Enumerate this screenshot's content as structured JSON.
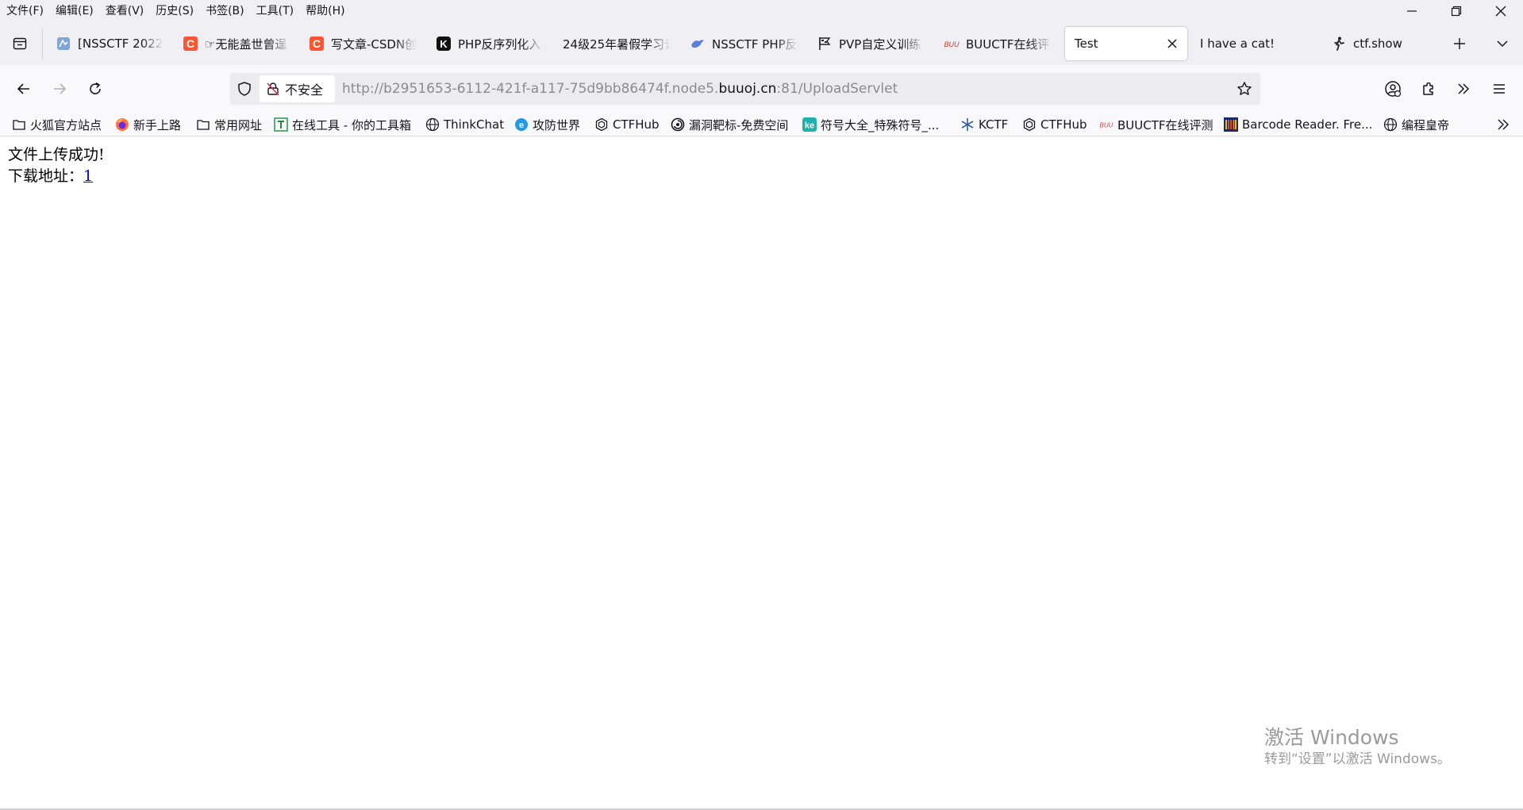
{
  "menubar": {
    "items": [
      "文件(F)",
      "编辑(E)",
      "查看(V)",
      "历史(S)",
      "书签(B)",
      "工具(T)",
      "帮助(H)"
    ]
  },
  "window_controls": [
    "minimize-icon",
    "restore-icon",
    "close-icon"
  ],
  "tabs": [
    {
      "label": "[NSSCTF 2022",
      "icon": "nssctf-logo-icon",
      "active": false
    },
    {
      "label": "☞无能盖世曾逞",
      "icon": "csdn-c-icon",
      "active": false
    },
    {
      "label": "写文章-CSDN创",
      "icon": "csdn-c-icon",
      "active": false
    },
    {
      "label": "PHP反序列化入",
      "icon": "k-logo-icon",
      "active": false
    },
    {
      "label": "24级25年暑假学习计",
      "icon": "",
      "active": false
    },
    {
      "label": "NSSCTF PHP反",
      "icon": "bird-icon",
      "active": false
    },
    {
      "label": "PVP自定义训练",
      "icon": "flag-icon",
      "active": false
    },
    {
      "label": "BUUCTF在线评",
      "icon": "buuctf-icon",
      "active": false
    },
    {
      "label": "Test",
      "icon": "",
      "active": true
    },
    {
      "label": "I have a cat!",
      "icon": "",
      "active": false
    },
    {
      "label": "ctf.show",
      "icon": "runner-icon",
      "active": false
    }
  ],
  "urlbar": {
    "security_label": "不安全",
    "url_prefix": "http://b2951653-6112-421f-a117-75d9bb86474f.node5.",
    "url_domain": "buuoj.cn",
    "url_suffix": ":81/UploadServlet"
  },
  "bookmarks": [
    {
      "label": "火狐官方站点",
      "icon": "folder-icon"
    },
    {
      "label": "新手上路",
      "icon": "firefox-icon"
    },
    {
      "label": "常用网址",
      "icon": "folder-icon"
    },
    {
      "label": "在线工具 - 你的工具箱",
      "icon": "tool-t-icon"
    },
    {
      "label": "ThinkChat",
      "icon": "globe-icon"
    },
    {
      "label": "攻防世界",
      "icon": "shield-e-icon"
    },
    {
      "label": "CTFHub",
      "icon": "hex-icon"
    },
    {
      "label": "漏洞靶标-免费空间",
      "icon": "spiral-icon"
    },
    {
      "label": "符号大全_特殊符号_...",
      "icon": "ke-icon"
    },
    {
      "label": "KCTF",
      "icon": "snowflake-icon"
    },
    {
      "label": "CTFHub",
      "icon": "hex-icon"
    },
    {
      "label": "BUUCTF在线评测",
      "icon": "buuctf-icon"
    },
    {
      "label": "Barcode Reader. Fre...",
      "icon": "barcode-icon"
    },
    {
      "label": "编程皇帝",
      "icon": "globe-icon"
    }
  ],
  "page": {
    "line1": "文件上传成功!",
    "line2_label": "下载地址：",
    "download_link": "1"
  },
  "watermark": {
    "title": "激活 Windows",
    "subtitle": "转到“设置”以激活 Windows。"
  },
  "colors": {
    "chrome_bg": "#f0f0f4",
    "toolbar_bg": "#f9f9fb",
    "urlbar_bg": "#ececf0",
    "link": "#0000ee",
    "csdn_red": "#fc5531"
  }
}
